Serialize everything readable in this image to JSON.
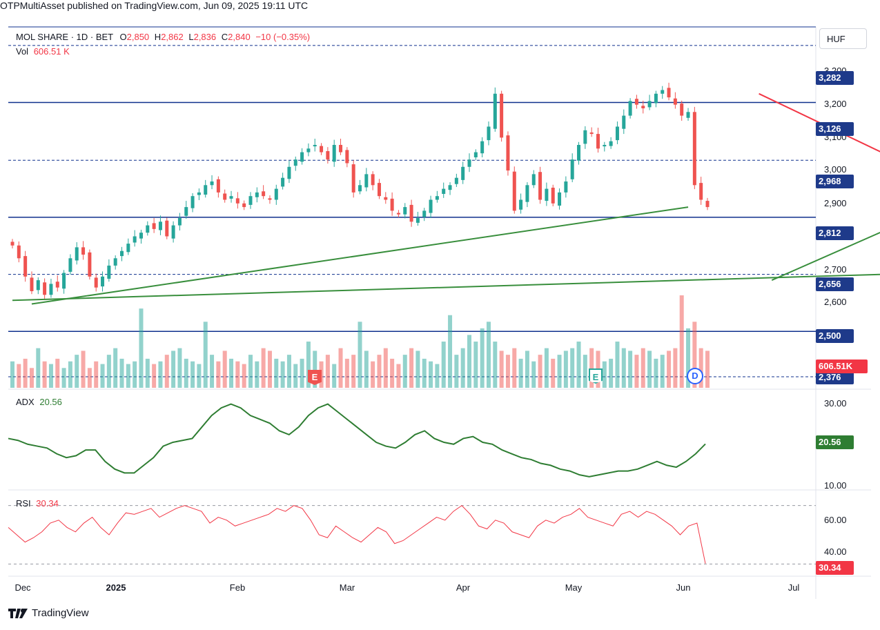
{
  "header": {
    "text": "OTPMultiAsset published on TradingView.com, Jun 09, 2025 19:11 UTC"
  },
  "legend": {
    "symbol": "MOL SHARE · 1D · BET",
    "o_label": "O",
    "o_value": "2,850",
    "h_label": "H",
    "h_value": "2,862",
    "l_label": "L",
    "l_value": "2,836",
    "c_label": "C",
    "c_value": "2,840",
    "change": "−10 (−0.35%)",
    "vol_label": "Vol",
    "vol_value": "606.51 K"
  },
  "currency_button": "HUF",
  "price_axis": {
    "ticks": [
      "3,200",
      "3,100",
      "3,000",
      "2,900",
      "2,700",
      "2,600"
    ]
  },
  "price_labels": [
    {
      "text": "3,282",
      "value": 3282
    },
    {
      "text": "3,126",
      "value": 3126
    },
    {
      "text": "2,968",
      "value": 2968
    },
    {
      "text": "2,812",
      "value": 2812
    },
    {
      "text": "2,656",
      "value": 2656
    },
    {
      "text": "2,500",
      "value": 2500
    },
    {
      "text": "2,376",
      "value": 2376
    }
  ],
  "volume_label": "606.51K",
  "adx": {
    "name": "ADX",
    "value": "20.56",
    "ticks": [
      "30.00",
      "10.00"
    ],
    "label": "20.56"
  },
  "rsi": {
    "name": "RSI",
    "value": "30.34",
    "ticks": [
      "60.00",
      "40.00"
    ],
    "label": "30.34"
  },
  "x_axis": {
    "ticks": [
      "Dec",
      "2025",
      "Feb",
      "Mar",
      "Apr",
      "May",
      "Jun",
      "Jul"
    ]
  },
  "events": [
    {
      "letter": "E",
      "kind": "earnings-down"
    },
    {
      "letter": "E",
      "kind": "earnings-up"
    },
    {
      "letter": "D",
      "kind": "dividend"
    }
  ],
  "footer": {
    "brand": "TradingView"
  },
  "colors": {
    "up": "#26a69a",
    "down": "#ef5350",
    "level": "#0d2f8c",
    "trend_green": "#388e3c",
    "trend_red": "#f23645",
    "adx": "#2e7d32",
    "rsi": "#f23645"
  },
  "chart_data": [
    {
      "type": "candlestick",
      "title": "MOL SHARE · 1D · BET",
      "ylim": [
        2376,
        3310
      ],
      "x_range": [
        "2024-11-28",
        "2025-07-08"
      ],
      "ohlc_close": [
        2735,
        2700,
        2650,
        2610,
        2640,
        2600,
        2630,
        2620,
        2660,
        2700,
        2730,
        2710,
        2650,
        2620,
        2650,
        2680,
        2700,
        2720,
        2740,
        2760,
        2770,
        2790,
        2780,
        2800,
        2760,
        2790,
        2810,
        2840,
        2870,
        2880,
        2900,
        2910,
        2880,
        2860,
        2870,
        2850,
        2840,
        2870,
        2880,
        2870,
        2860,
        2890,
        2920,
        2950,
        2970,
        2990,
        3000,
        3010,
        2990,
        2970,
        3010,
        2990,
        2960,
        2880,
        2900,
        2930,
        2900,
        2870,
        2860,
        2830,
        2820,
        2840,
        2800,
        2810,
        2830,
        2860,
        2870,
        2890,
        2900,
        2920,
        2950,
        2970,
        2990,
        3020,
        3060,
        3150,
        3030,
        2940,
        2830,
        2860,
        2900,
        2930,
        2860,
        2890,
        2850,
        2880,
        2910,
        2970,
        3010,
        3050,
        3040,
        3000,
        3010,
        3020,
        3060,
        3090,
        3130,
        3120,
        3110,
        3130,
        3150,
        3160,
        3140,
        3120,
        3090,
        3100,
        2900,
        2860,
        2840
      ],
      "trendlines": [
        {
          "color": "green",
          "from": [
            0,
            2585
          ],
          "to": [
            200,
            2690
          ]
        },
        {
          "color": "green",
          "from": [
            3,
            2575
          ],
          "to": [
            105,
            2840
          ]
        },
        {
          "color": "green",
          "from": [
            118,
            2640
          ],
          "to": [
            173,
            3066
          ]
        },
        {
          "color": "red",
          "from": [
            116,
            3150
          ],
          "to": [
            143,
            2923
          ]
        },
        {
          "color": "red",
          "from": [
            162,
            3170
          ],
          "to": [
            193,
            2942
          ]
        }
      ]
    },
    {
      "type": "bar",
      "name": "Vol",
      "note": "volume histogram, relative heights",
      "values": [
        20,
        18,
        22,
        15,
        30,
        20,
        18,
        22,
        15,
        20,
        25,
        28,
        15,
        20,
        18,
        25,
        30,
        22,
        18,
        20,
        60,
        22,
        18,
        20,
        25,
        28,
        30,
        22,
        20,
        18,
        50,
        25,
        20,
        28,
        22,
        20,
        18,
        25,
        20,
        30,
        28,
        22,
        20,
        25,
        18,
        22,
        35,
        28,
        20,
        25,
        18,
        30,
        22,
        25,
        50,
        28,
        20,
        25,
        30,
        22,
        18,
        25,
        30,
        28,
        22,
        20,
        18,
        35,
        55,
        25,
        30,
        40,
        35,
        45,
        50,
        35,
        28,
        25,
        30,
        22,
        28,
        20,
        25,
        30,
        22,
        25,
        28,
        30,
        35,
        25,
        30,
        28,
        20,
        22,
        35,
        30,
        28,
        25,
        30,
        28,
        22,
        25,
        28,
        30,
        70,
        45,
        50,
        30,
        28
      ]
    },
    {
      "type": "line",
      "name": "ADX",
      "ylim": [
        10,
        32
      ],
      "values": [
        22,
        21.5,
        20.5,
        20,
        19.5,
        18,
        17,
        17.5,
        19,
        19,
        16,
        14,
        13,
        13,
        15,
        17,
        20,
        21,
        21.5,
        22,
        25,
        28,
        30,
        31,
        30,
        28,
        27,
        26,
        24,
        23,
        25,
        28,
        30,
        31,
        29,
        27,
        25,
        23,
        21,
        20,
        19.5,
        21,
        23,
        24,
        22,
        21,
        20.5,
        22,
        22.5,
        21,
        20.5,
        19,
        18,
        17,
        16.5,
        15.5,
        15,
        14,
        13.5,
        12.5,
        12,
        12.5,
        13,
        13.5,
        13.5,
        14,
        15,
        16,
        15,
        14.5,
        16,
        18,
        20.56
      ]
    },
    {
      "type": "line",
      "name": "RSI",
      "ylim": [
        25,
        75
      ],
      "values": [
        55,
        50,
        45,
        48,
        52,
        58,
        60,
        55,
        52,
        58,
        62,
        55,
        50,
        58,
        65,
        64,
        66,
        68,
        62,
        65,
        68,
        70,
        68,
        66,
        58,
        62,
        60,
        56,
        58,
        60,
        62,
        64,
        68,
        66,
        70,
        68,
        60,
        50,
        48,
        56,
        52,
        48,
        45,
        50,
        55,
        52,
        44,
        46,
        50,
        54,
        58,
        62,
        60,
        66,
        70,
        64,
        56,
        54,
        60,
        58,
        52,
        50,
        48,
        56,
        60,
        58,
        62,
        64,
        68,
        62,
        60,
        58,
        56,
        64,
        66,
        62,
        66,
        64,
        60,
        56,
        50,
        56,
        58,
        30.34
      ]
    }
  ]
}
